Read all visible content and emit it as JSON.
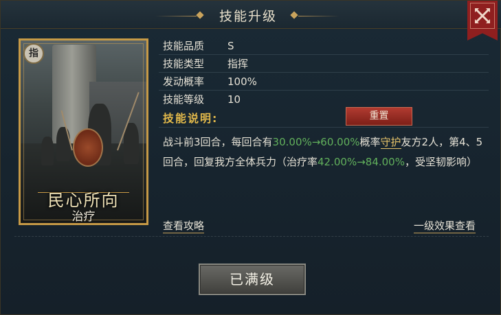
{
  "window": {
    "title": "技能升级"
  },
  "card": {
    "badge": "指",
    "name": "民心所向",
    "sub": "治疗"
  },
  "info": [
    {
      "label": "技能品质",
      "value": "S"
    },
    {
      "label": "技能类型",
      "value": "指挥"
    },
    {
      "label": "发动概率",
      "value": "100%"
    },
    {
      "label": "技能等级",
      "value": "10"
    }
  ],
  "description": {
    "label": "技能说明:",
    "reset_label": "重置",
    "parts": [
      {
        "t": "战斗前3回合，每回合有",
        "s": "n"
      },
      {
        "t": "30.00%→60.00%",
        "s": "g"
      },
      {
        "t": "概率",
        "s": "n"
      },
      {
        "t": "守护",
        "s": "u"
      },
      {
        "t": "友方2人，第4、5回合，回复我方全体兵力（治疗率",
        "s": "n"
      },
      {
        "t": "42.00%→84.00%",
        "s": "g"
      },
      {
        "t": "，受坚韧影响）",
        "s": "n"
      }
    ]
  },
  "links": {
    "guide": "查看攻略",
    "level1": "一级效果查看"
  },
  "button": {
    "label": "已满级"
  },
  "colors": {
    "accent_gold": "#c79a46",
    "highlight_green": "#62b15c",
    "label_gold": "#e2b94a",
    "reset_red": "#9a2e25"
  },
  "icons": {
    "close": "close-x-icon",
    "badge": "command-badge-icon"
  }
}
